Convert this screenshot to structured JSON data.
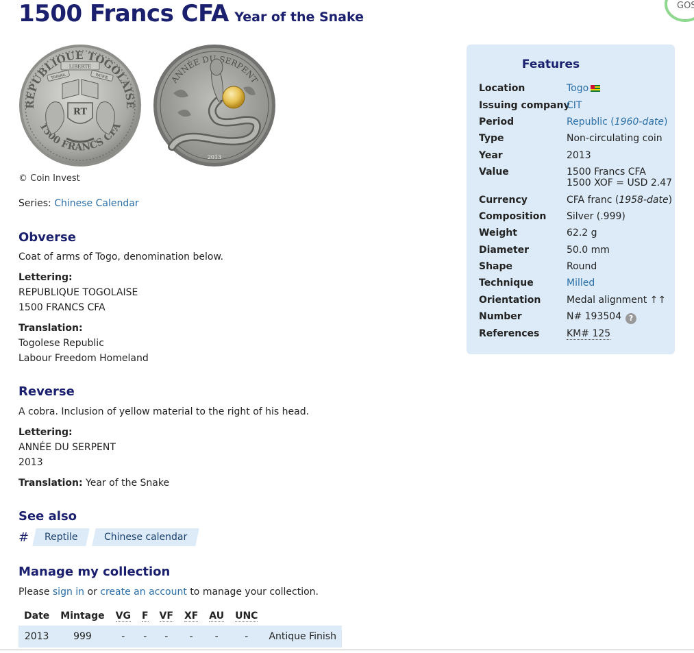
{
  "header": {
    "title": "1500 Francs CFA",
    "subtitle": "Year of the Snake"
  },
  "corner_badge": "GOS",
  "images": {
    "obverse_legend_top": "REPUBLIQUE TOGOLAISE",
    "obverse_legend_bottom": "1500 FRANCS CFA",
    "obverse_banner": "LIBERTE",
    "obverse_left_ribbon": "TRAVAIL",
    "obverse_right_ribbon": "PATRIE",
    "obverse_monogram": "RT",
    "reverse_legend": "ANNÉE DU SERPENT",
    "reverse_year": "2013",
    "credit": "© Coin Invest"
  },
  "series": {
    "label": "Series:",
    "link": "Chinese Calendar"
  },
  "obverse": {
    "heading": "Obverse",
    "description": "Coat of arms of Togo, denomination below.",
    "lettering_label": "Lettering:",
    "lettering_lines": [
      "REPUBLIQUE TOGOLAISE",
      "1500 FRANCS CFA"
    ],
    "translation_label": "Translation:",
    "translation_lines": [
      "Togolese Republic",
      "Labour Freedom Homeland"
    ]
  },
  "reverse": {
    "heading": "Reverse",
    "description": "A cobra. Inclusion of yellow material to the right of his head.",
    "lettering_label": "Lettering:",
    "lettering_lines": [
      "ANNÉE DU SERPENT",
      "2013"
    ],
    "translation_label": "Translation:",
    "translation_value": "Year of the Snake"
  },
  "see_also": {
    "heading": "See also",
    "hash": "#",
    "tags": [
      "Reptile",
      "Chinese calendar"
    ]
  },
  "manage": {
    "heading": "Manage my collection",
    "text_before": "Please",
    "sign_in": "sign in",
    "or": "or",
    "create_account": "create an account",
    "text_after": "to manage your collection."
  },
  "mintage_table": {
    "headers": [
      "Date",
      "Mintage",
      "VG",
      "F",
      "VF",
      "XF",
      "AU",
      "UNC"
    ],
    "rows": [
      {
        "date": "2013",
        "mintage": "999",
        "vg": "-",
        "f": "-",
        "vf": "-",
        "xf": "-",
        "au": "-",
        "unc": "-",
        "note": "Antique Finish"
      }
    ]
  },
  "features": {
    "heading": "Features",
    "rows": [
      {
        "key": "Location",
        "value": "Togo"
      },
      {
        "key": "Issuing company",
        "value": "CIT"
      },
      {
        "key": "Period",
        "value": "Republic",
        "value_extra": "1960-date"
      },
      {
        "key": "Type",
        "value": "Non-circulating coin"
      },
      {
        "key": "Year",
        "value": "2013"
      },
      {
        "key": "Value",
        "value": "1500 Francs CFA",
        "value_line2": "1500 XOF = USD 2.47"
      },
      {
        "key": "Currency",
        "value": "CFA franc",
        "value_extra": "1958-date"
      },
      {
        "key": "Composition",
        "value": "Silver (.999)"
      },
      {
        "key": "Weight",
        "value": "62.2 g"
      },
      {
        "key": "Diameter",
        "value": "50.0 mm"
      },
      {
        "key": "Shape",
        "value": "Round"
      },
      {
        "key": "Technique",
        "value": "Milled"
      },
      {
        "key": "Orientation",
        "value": "Medal alignment ↑↑"
      },
      {
        "key": "Number",
        "value": "N# 193504",
        "help": "?"
      },
      {
        "key": "References",
        "value": "KM# 125"
      }
    ]
  },
  "colors": {
    "heading": "#1a1f6e",
    "link": "#2a6ea8",
    "panel": "#dcebf7"
  }
}
